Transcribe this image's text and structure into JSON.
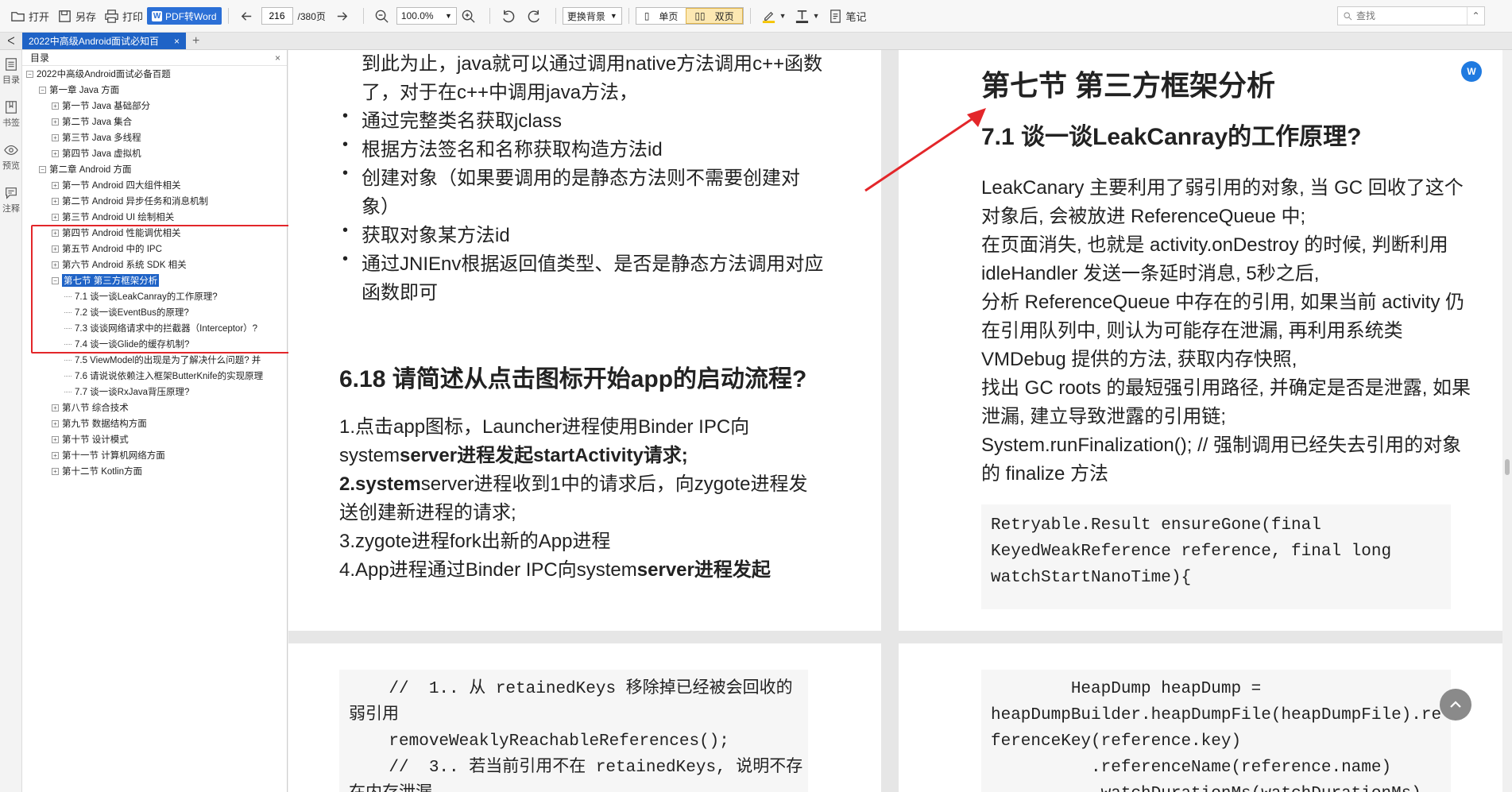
{
  "toolbar": {
    "open": "打开",
    "save_as": "另存",
    "print": "打印",
    "pdf_to_word": "PDF转Word",
    "page_current": "216",
    "page_total": "/380页",
    "zoom": "100.0%",
    "background": "更换背景",
    "single_page": "单页",
    "double_page": "双页",
    "notes": "笔记",
    "search_placeholder": "查找"
  },
  "tab": {
    "title": "2022中高级Android面试必知百",
    "close": "×",
    "add": "+"
  },
  "rail": {
    "toc": "目录",
    "bookmark": "书签",
    "preview": "预览",
    "annotation": "注释"
  },
  "toc": {
    "header": "目录",
    "close": "×",
    "items": [
      {
        "label": "2022中高级Android面试必备百题",
        "level": 0,
        "expanded": true
      },
      {
        "label": "第一章 Java 方面",
        "level": 1,
        "expanded": true
      },
      {
        "label": "第一节 Java 基础部分",
        "level": 2,
        "expanded": false
      },
      {
        "label": "第二节 Java 集合",
        "level": 2,
        "expanded": false
      },
      {
        "label": "第三节 Java 多线程",
        "level": 2,
        "expanded": false
      },
      {
        "label": "第四节 Java 虚拟机",
        "level": 2,
        "expanded": false
      },
      {
        "label": "第二章 Android 方面",
        "level": 1,
        "expanded": true
      },
      {
        "label": "第一节 Android 四大组件相关",
        "level": 2,
        "expanded": false
      },
      {
        "label": "第二节 Android 异步任务和消息机制",
        "level": 2,
        "expanded": false
      },
      {
        "label": "第三节 Android UI 绘制相关",
        "level": 2,
        "expanded": false
      },
      {
        "label": "第四节 Android 性能调优相关",
        "level": 2,
        "expanded": false
      },
      {
        "label": "第五节 Android 中的 IPC",
        "level": 2,
        "expanded": false
      },
      {
        "label": "第六节 Android 系统 SDK 相关",
        "level": 2,
        "expanded": false
      },
      {
        "label": "第七节 第三方框架分析",
        "level": 2,
        "expanded": true,
        "selected": true
      },
      {
        "label": "7.1 谈一谈LeakCanray的工作原理?",
        "level": 3
      },
      {
        "label": "7.2 谈一谈EventBus的原理?",
        "level": 3
      },
      {
        "label": "7.3 谈谈网络请求中的拦截器（Interceptor）?",
        "level": 3
      },
      {
        "label": "7.4 谈一谈Glide的缓存机制?",
        "level": 3
      },
      {
        "label": "7.5 ViewModel的出现是为了解决什么问题? 并",
        "level": 3
      },
      {
        "label": "7.6 请说说依赖注入框架ButterKnife的实现原理",
        "level": 3
      },
      {
        "label": "7.7 谈一谈RxJava背压原理?",
        "level": 3
      },
      {
        "label": "第八节 综合技术",
        "level": 2,
        "expanded": false
      },
      {
        "label": "第九节 数据结构方面",
        "level": 2,
        "expanded": false
      },
      {
        "label": "第十节 设计模式",
        "level": 2,
        "expanded": false
      },
      {
        "label": "第十一节 计算机网络方面",
        "level": 2,
        "expanded": false
      },
      {
        "label": "第十二节 Kotlin方面",
        "level": 2,
        "expanded": false
      }
    ]
  },
  "page_left_top": {
    "line1": "到此为止，java就可以通过调用native方法调用c++函数",
    "line2": "了，对于在c++中调用java方法，",
    "bullets": [
      [
        "通过完整类名获取jclass"
      ],
      [
        "根据方法签名和名称获取构造方法id"
      ],
      [
        "创建对象（如果要调用的是静态方法则不需要创建对",
        "象）"
      ],
      [
        "获取对象某方法id"
      ],
      [
        "通过JNIEnv根据返回值类型、是否是静态方法调用对应",
        "函数即可"
      ]
    ],
    "heading": "6.18 请简述从点击图标开始app的启动流程?",
    "steps": {
      "s1a": "1.点击app图标，Launcher进程使用Binder IPC向",
      "s1b_normal": "system",
      "s1b_bold": "server进程发起startActivity请求;",
      "s2a_bold": "2.system",
      "s2a_normal": "server进程收到1中的请求后，向zygote进程发",
      "s2b": "送创建新进程的请求;",
      "s3": "3.zygote进程fork出新的App进程",
      "s4_normal": "4.App进程通过Binder IPC向system",
      "s4_bold": "server进程发起"
    }
  },
  "page_right_top": {
    "chapter": "第七节 第三方框架分析",
    "heading": "7.1 谈一谈LeakCanray的工作原理?",
    "paragraph": [
      "LeakCanary 主要利用了弱引用的对象, 当 GC 回收了这个",
      "对象后, 会被放进 ReferenceQueue 中;",
      "在页面消失, 也就是 activity.onDestroy 的时候, 判断利用",
      "idleHandler 发送一条延时消息, 5秒之后,",
      "分析 ReferenceQueue 中存在的引用, 如果当前 activity 仍",
      "在引用队列中, 则认为可能存在泄漏, 再利用系统类",
      "VMDebug 提供的方法, 获取内存快照,",
      "找出 GC roots 的最短强引用路径, 并确定是否是泄露, 如果",
      "泄漏, 建立导致泄露的引用链;",
      "System.runFinalization(); // 强制调用已经失去引用的对象",
      "的 finalize 方法"
    ],
    "code": [
      "Retryable.Result ensureGone(final",
      "KeyedWeakReference reference, final long",
      "watchStartNanoTime){"
    ]
  },
  "page_left_bottom": {
    "code": [
      "    //  1.. 从 retainedKeys 移除掉已经被会回收的",
      "弱引用",
      "    removeWeaklyReachableReferences();",
      "    //  3.. 若当前引用不在 retainedKeys, 说明不存",
      "在内存泄漏"
    ]
  },
  "page_right_bottom": {
    "code": [
      "        HeapDump heapDump =",
      "heapDumpBuilder.heapDumpFile(heapDumpFile).re",
      "ferenceKey(reference.key)",
      "          .referenceName(reference.name)",
      "          .watchDurationMs(watchDurationMs)"
    ]
  },
  "colors": {
    "accent": "#1f63c6",
    "highlight_box": "#e3262a",
    "arrow": "#e3262a"
  }
}
